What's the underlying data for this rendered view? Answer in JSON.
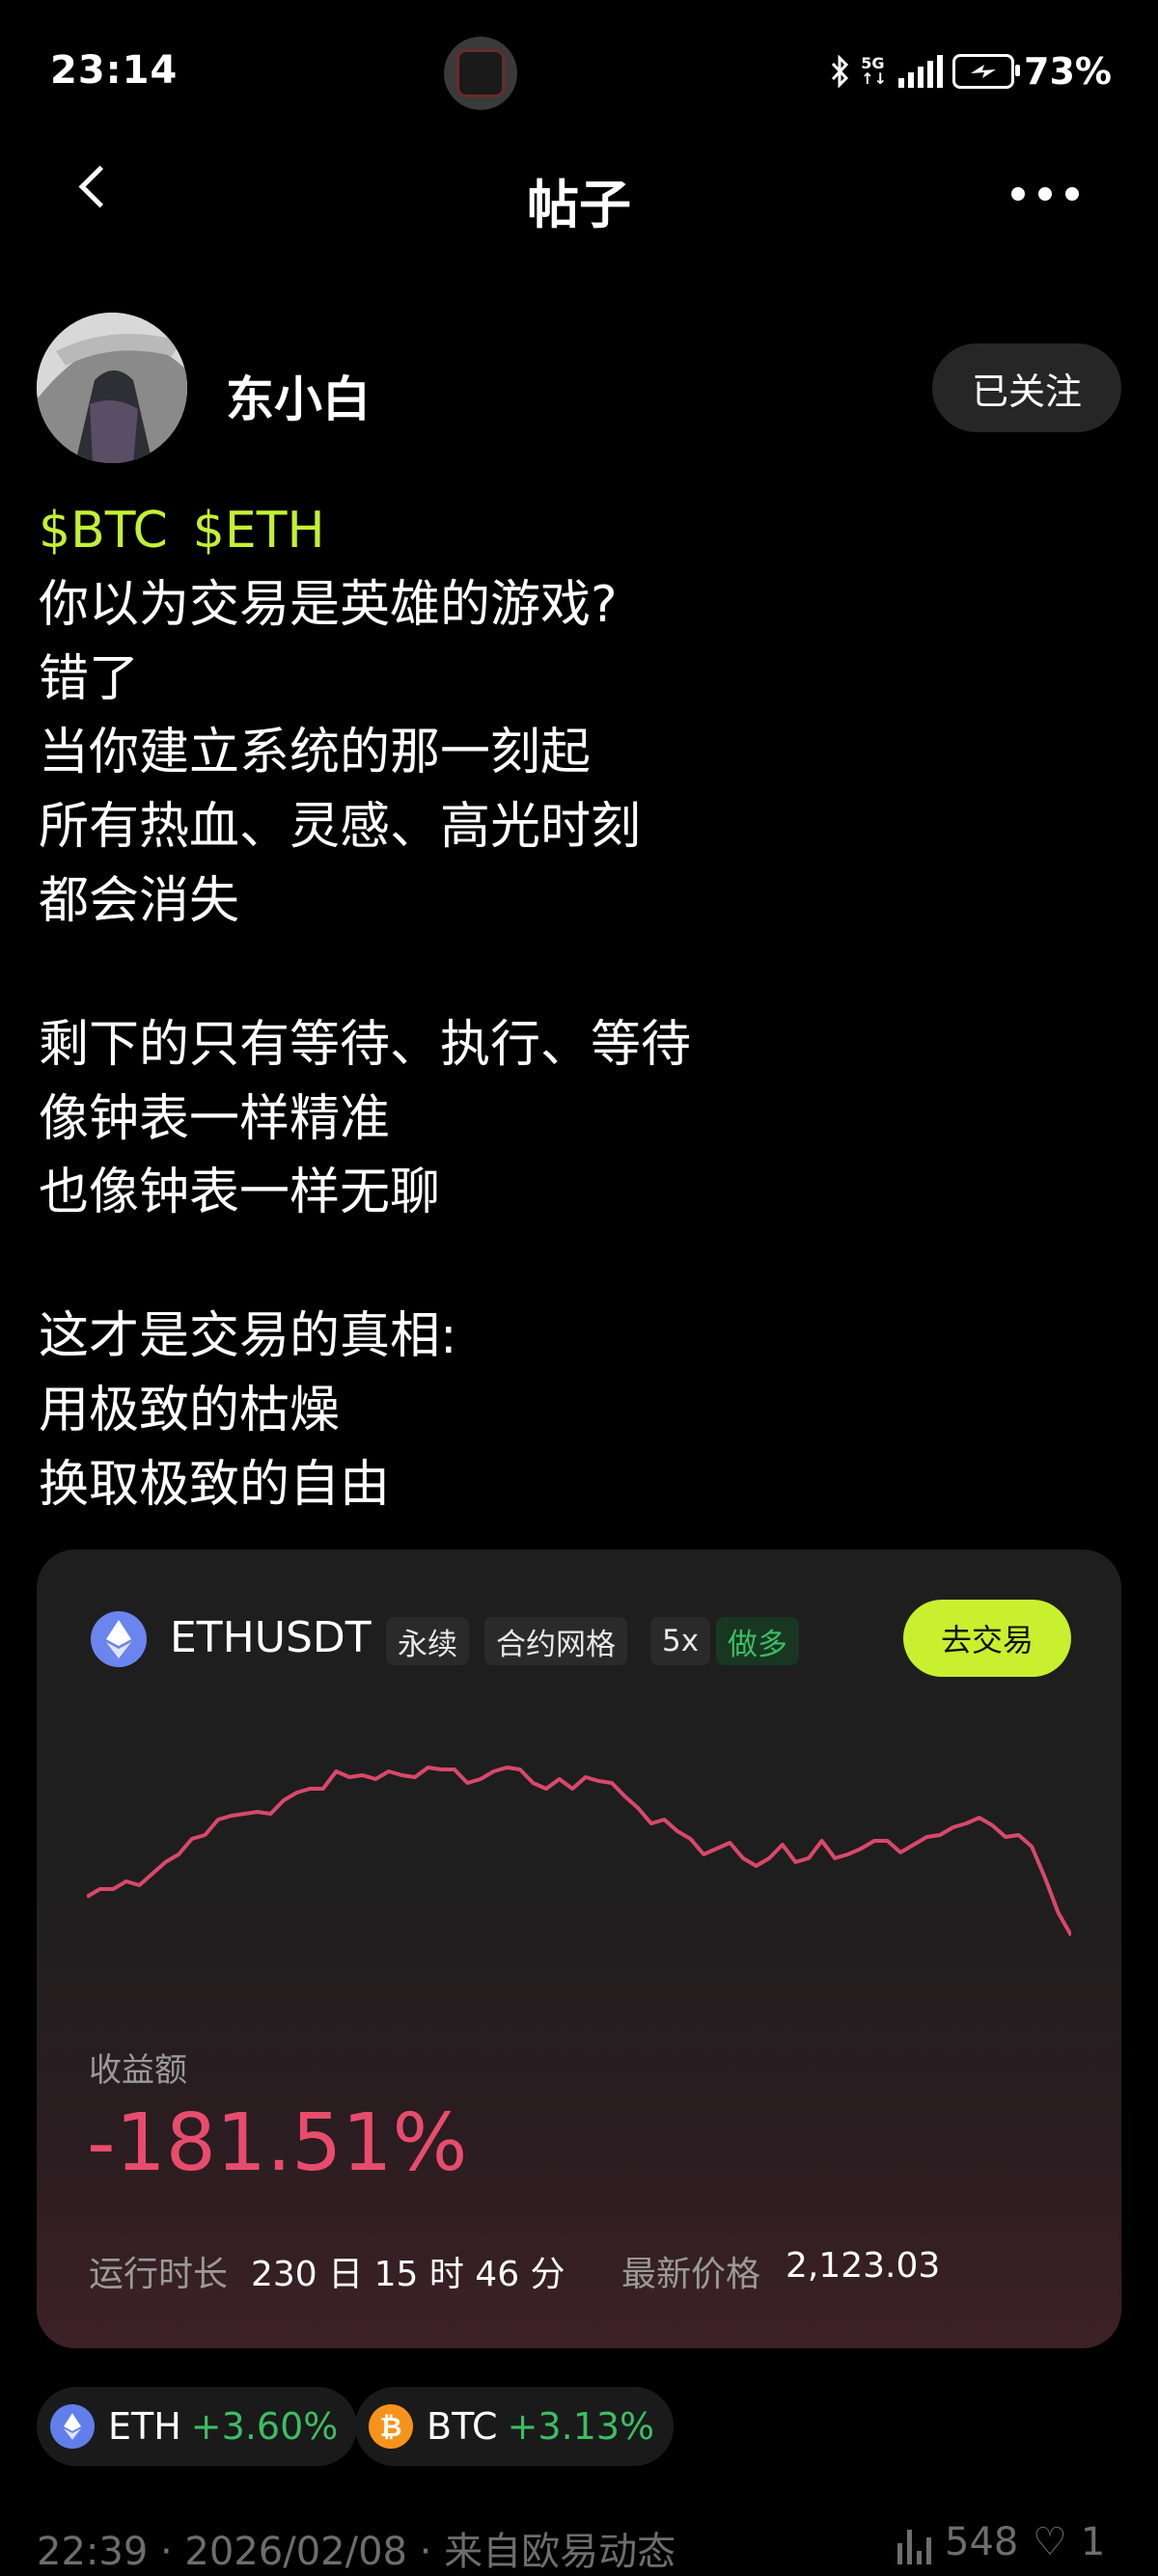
{
  "status_bar": {
    "time": "23:14",
    "network": "5G",
    "battery": "73%"
  },
  "header": {
    "title": "帖子"
  },
  "author": {
    "name": "东小白",
    "follow_label": "已关注"
  },
  "post": {
    "tags": [
      "$BTC",
      "$ETH"
    ],
    "paragraphs": [
      [
        "你以为交易是英雄的游戏?",
        "错了",
        "当你建立系统的那一刻起",
        "所有热血、灵感、高光时刻",
        "都会消失"
      ],
      [
        "剩下的只有等待、执行、等待",
        "像钟表一样精准",
        "也像钟表一样无聊"
      ],
      [
        "这才是交易的真相:",
        "用极致的枯燥",
        "换取极致的自由"
      ]
    ]
  },
  "card": {
    "symbol": "ETHUSDT",
    "tags": [
      "永续",
      "合约网格",
      "5x",
      "做多"
    ],
    "trade_button": "去交易",
    "pl_label": "收益额",
    "pl_value": "-181.51%",
    "runtime_label": "运行时长",
    "runtime_value": "230 日 15 时 46 分",
    "price_label": "最新价格",
    "price_value": "2,123.03",
    "line_color": "#d9486a"
  },
  "chart_data": {
    "type": "line",
    "title": "",
    "xlabel": "",
    "ylabel": "",
    "values": [
      0.3,
      0.34,
      0.34,
      0.38,
      0.36,
      0.42,
      0.48,
      0.52,
      0.6,
      0.62,
      0.7,
      0.72,
      0.73,
      0.74,
      0.73,
      0.8,
      0.84,
      0.86,
      0.86,
      0.95,
      0.92,
      0.93,
      0.91,
      0.95,
      0.93,
      0.92,
      0.97,
      0.96,
      0.96,
      0.89,
      0.91,
      0.95,
      0.97,
      0.96,
      0.89,
      0.86,
      0.91,
      0.86,
      0.92,
      0.9,
      0.89,
      0.82,
      0.76,
      0.68,
      0.7,
      0.64,
      0.6,
      0.52,
      0.55,
      0.58,
      0.5,
      0.46,
      0.5,
      0.57,
      0.48,
      0.5,
      0.59,
      0.5,
      0.52,
      0.55,
      0.59,
      0.59,
      0.53,
      0.57,
      0.61,
      0.62,
      0.66,
      0.68,
      0.71,
      0.67,
      0.61,
      0.62,
      0.56,
      0.4,
      0.22,
      0.1
    ]
  },
  "coins": [
    {
      "symbol": "ETH",
      "change": "+3.60%",
      "color": "#627eea",
      "icon": "ethereum-icon"
    },
    {
      "symbol": "BTC",
      "change": "+3.13%",
      "color": "#f7931a",
      "icon": "bitcoin-icon"
    }
  ],
  "footer": {
    "meta": "22:39 · 2026/02/08 · 来自欧易动态",
    "views": "548",
    "likes": "1"
  }
}
